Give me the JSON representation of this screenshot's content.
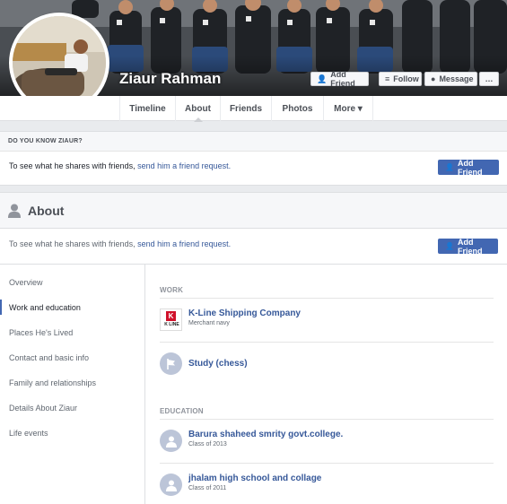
{
  "profile": {
    "name": "Ziaur Rahman"
  },
  "cover_actions": {
    "add_friend": "Add Friend",
    "follow": "Follow",
    "message": "Message",
    "more": "…"
  },
  "tabs": [
    {
      "label": "Timeline"
    },
    {
      "label": "About"
    },
    {
      "label": "Friends"
    },
    {
      "label": "Photos"
    },
    {
      "label": "More ▾"
    }
  ],
  "know_box": {
    "heading": "DO YOU KNOW ZIAUR?",
    "text_before": "To see what he shares with friends, ",
    "link": "send him a friend request.",
    "button": "Add Friend"
  },
  "about": {
    "heading": "About",
    "text_before": "To see what he shares with friends, ",
    "link": "send him a friend request.",
    "button": "Add Friend",
    "sidebar": [
      {
        "label": "Overview"
      },
      {
        "label": "Work and education"
      },
      {
        "label": "Places He's Lived"
      },
      {
        "label": "Contact and basic info"
      },
      {
        "label": "Family and relationships"
      },
      {
        "label": "Details About Ziaur"
      },
      {
        "label": "Life events"
      }
    ],
    "work_title": "WORK",
    "work": [
      {
        "title": "K-Line Shipping Company",
        "subtitle": "Merchant navy",
        "logo_text": "K LINE"
      },
      {
        "title": "Study (chess)",
        "subtitle": ""
      }
    ],
    "education_title": "EDUCATION",
    "education": [
      {
        "title": "Barura shaheed smrity govt.college.",
        "subtitle": "Class of 2013"
      },
      {
        "title": "jhalam high school and collage",
        "subtitle": "Class of 2011"
      }
    ]
  },
  "colors": {
    "accent": "#4267b2",
    "link": "#365899",
    "background": "#e9ebee"
  }
}
